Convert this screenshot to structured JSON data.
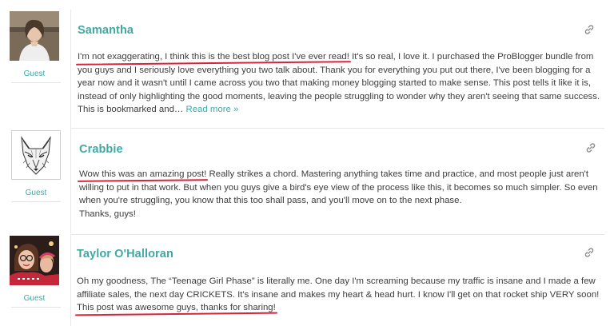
{
  "comments": [
    {
      "name": "Samantha",
      "role": "Guest",
      "highlight": "I'm not exaggerating, I think this is the best blog post I've ever read!",
      "text": " It's so real, I love it. I purchased the ProBlogger bundle from you guys and I seriously love everything you two talk about. Thank you for everything you put out there, I've been blogging for a year now and it wasn't until I came across you two that making money blogging started to make sense. This post tells it like it is, instead of only highlighting the good moments, leaving the people struggling to wonder why they aren't seeing that same success. This is bookmarked and… ",
      "readmore": "Read more »"
    },
    {
      "name": "Crabbie",
      "role": "Guest",
      "highlight": "Wow this was an amazing post!",
      "text": " Really strikes a chord. Mastering anything takes time and practice, and most people just aren't willing to put in that work. But when you guys give a bird's eye view of the process like this, it becomes so much simpler. So even when you're struggling, you know that this too shall pass, and you'll move on to the next phase.",
      "text2": "Thanks, guys!"
    },
    {
      "name": "Taylor O'Halloran",
      "role": "Guest",
      "text": "Oh my goodness, The “Teenage Girl Phase” is literally me. One day I'm screaming because my traffic is insane and I made a few affiliate sales, the next day CRICKETS. It's insane and makes my heart & head hurt. I know I'll get on that rocket ship VERY soon! ",
      "highlight": "This post was awesome guys, thanks for sharing!"
    }
  ],
  "colors": {
    "accent": "#3fa9a4",
    "highlight_underline": "#d8243a"
  },
  "icons": {
    "permalink": "link-icon"
  }
}
